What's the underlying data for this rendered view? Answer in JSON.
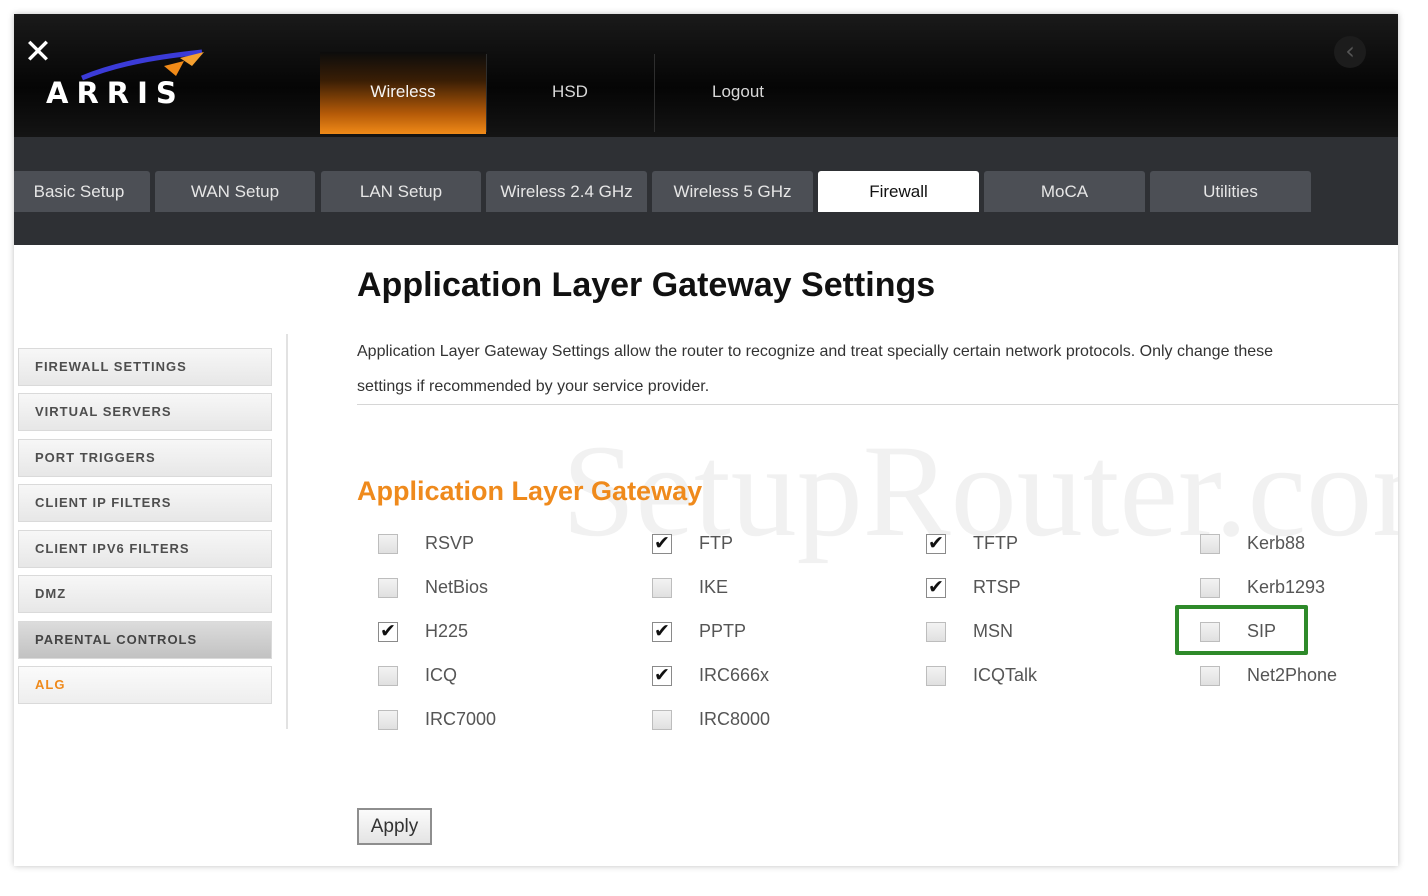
{
  "header": {
    "logo_text": "ARRIS",
    "top_tabs": [
      "Wireless",
      "HSD",
      "Logout"
    ],
    "active_top_tab": "Wireless",
    "close_icon": "close-icon",
    "back_icon": "chevron-left-icon"
  },
  "subnav": {
    "tabs": [
      "Basic Setup",
      "WAN Setup",
      "LAN Setup",
      "Wireless 2.4 GHz",
      "Wireless 5 GHz",
      "Firewall",
      "MoCA",
      "Utilities"
    ],
    "active_tab": "Firewall"
  },
  "sidebar": {
    "items": [
      "FIREWALL SETTINGS",
      "VIRTUAL SERVERS",
      "PORT TRIGGERS",
      "CLIENT IP FILTERS",
      "CLIENT IPV6 FILTERS",
      "DMZ",
      "PARENTAL CONTROLS",
      "ALG"
    ],
    "selected_item": "PARENTAL CONTROLS",
    "active_item": "ALG"
  },
  "main": {
    "title": "Application Layer Gateway Settings",
    "description_line1": "Application Layer Gateway Settings allow the router to recognize and treat specially certain network protocols. Only change these",
    "description_line2": "settings if recommended by your service provider.",
    "section_title": "Application Layer Gateway",
    "watermark": "SetupRouter.com",
    "protocols": [
      {
        "label": "RSVP",
        "checked": false
      },
      {
        "label": "FTP",
        "checked": true
      },
      {
        "label": "TFTP",
        "checked": true
      },
      {
        "label": "Kerb88",
        "checked": false
      },
      {
        "label": "NetBios",
        "checked": false
      },
      {
        "label": "IKE",
        "checked": false
      },
      {
        "label": "RTSP",
        "checked": true
      },
      {
        "label": "Kerb1293",
        "checked": false
      },
      {
        "label": "H225",
        "checked": true
      },
      {
        "label": "PPTP",
        "checked": true
      },
      {
        "label": "MSN",
        "checked": false
      },
      {
        "label": "SIP",
        "checked": false
      },
      {
        "label": "ICQ",
        "checked": false
      },
      {
        "label": "IRC666x",
        "checked": true
      },
      {
        "label": "ICQTalk",
        "checked": false
      },
      {
        "label": "Net2Phone",
        "checked": false
      },
      {
        "label": "IRC7000",
        "checked": false
      },
      {
        "label": "IRC8000",
        "checked": false
      }
    ],
    "highlight_color": "#2e8a2a",
    "apply_label": "Apply"
  },
  "colors": {
    "accent_orange": "#ef8a1c",
    "header_bg": "#0a0a0a",
    "subnav_bg": "#2e3034"
  }
}
